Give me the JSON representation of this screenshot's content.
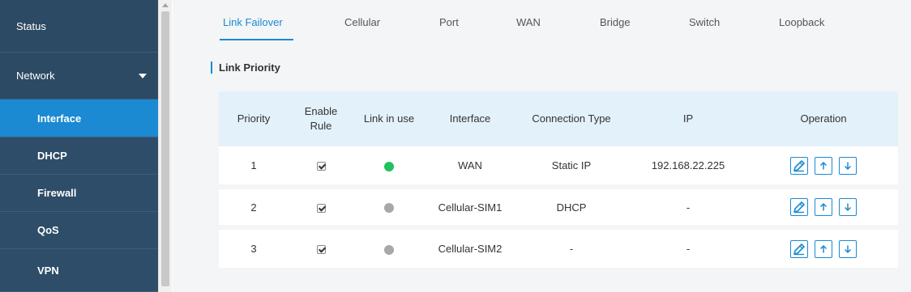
{
  "sidebar": {
    "items": [
      {
        "label": "Status"
      },
      {
        "label": "Network"
      },
      {
        "label": "Interface"
      },
      {
        "label": "DHCP"
      },
      {
        "label": "Firewall"
      },
      {
        "label": "QoS"
      },
      {
        "label": "VPN"
      }
    ]
  },
  "tabs": [
    {
      "label": "Link Failover"
    },
    {
      "label": "Cellular"
    },
    {
      "label": "Port"
    },
    {
      "label": "WAN"
    },
    {
      "label": "Bridge"
    },
    {
      "label": "Switch"
    },
    {
      "label": "Loopback"
    }
  ],
  "section": {
    "title": "Link Priority"
  },
  "table": {
    "headers": {
      "priority": "Priority",
      "enable_rule_1": "Enable",
      "enable_rule_2": "Rule",
      "link_in_use": "Link in use",
      "interface": "Interface",
      "connection_type": "Connection Type",
      "ip": "IP",
      "operation": "Operation"
    },
    "rows": [
      {
        "priority": "1",
        "enabled": true,
        "link_status_color": "#22c15e",
        "interface": "WAN",
        "connection_type": "Static IP",
        "ip": "192.168.22.225"
      },
      {
        "priority": "2",
        "enabled": true,
        "link_status_color": "#a8a8a8",
        "interface": "Cellular-SIM1",
        "connection_type": "DHCP",
        "ip": "-"
      },
      {
        "priority": "3",
        "enabled": true,
        "link_status_color": "#a8a8a8",
        "interface": "Cellular-SIM2",
        "connection_type": "-",
        "ip": "-"
      }
    ]
  },
  "icons": {
    "edit": "edit-icon",
    "move_up": "arrow-up-icon",
    "move_down": "arrow-down-icon",
    "expand": "chevron-down-icon"
  },
  "colors": {
    "sidebar_bg": "#2c4a63",
    "accent": "#1b8ad2",
    "header_bg": "#e3f1fb",
    "link_up": "#22c15e",
    "link_down": "#a8a8a8"
  }
}
